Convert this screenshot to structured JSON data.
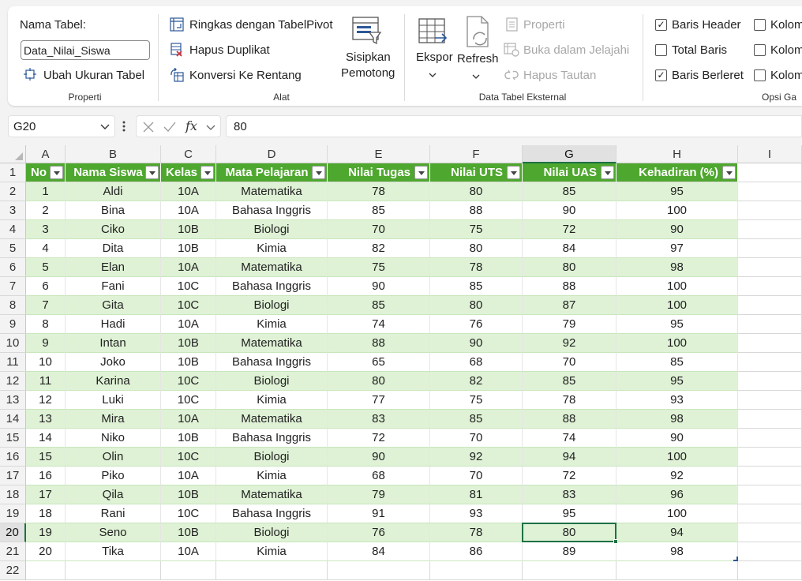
{
  "ribbon": {
    "properti": {
      "group_label": "Properti",
      "table_name_label": "Nama Tabel:",
      "table_name_value": "Data_Nilai_Siswa",
      "resize_label": "Ubah Ukuran Tabel"
    },
    "alat": {
      "group_label": "Alat",
      "pivot_label": "Ringkas dengan TabelPivot",
      "dedupe_label": "Hapus Duplikat",
      "convert_label": "Konversi Ke Rentang",
      "slicer_label_1": "Sisipkan",
      "slicer_label_2": "Pemotong"
    },
    "external": {
      "group_label": "Data Tabel Eksternal",
      "export_label": "Ekspor",
      "refresh_label": "Refresh",
      "properties_label": "Properti",
      "browser_label": "Buka dalam Jelajahi",
      "unlink_label": "Hapus Tautan"
    },
    "style_options": {
      "group_label": "Opsi Ga",
      "header_row_label": "Baris Header",
      "header_row_checked": true,
      "total_row_label": "Total Baris",
      "total_row_checked": false,
      "banded_rows_label": "Baris Berleret",
      "banded_rows_checked": true,
      "col1_label": "Kolom",
      "col2_label": "Kolom",
      "col3_label": "Kolom"
    }
  },
  "formula_bar": {
    "name_box": "G20",
    "formula": "80"
  },
  "columns": [
    "A",
    "B",
    "C",
    "D",
    "E",
    "F",
    "G",
    "H",
    "I"
  ],
  "selected_column": "G",
  "selected_row": 20,
  "table": {
    "headers": [
      "No",
      "Nama Siswa",
      "Kelas",
      "Mata Pelajaran",
      "Nilai Tugas",
      "Nilai UTS",
      "Nilai UAS",
      "Kehadiran (%)"
    ],
    "rows": [
      [
        "1",
        "Aldi",
        "10A",
        "Matematika",
        "78",
        "80",
        "85",
        "95"
      ],
      [
        "2",
        "Bina",
        "10A",
        "Bahasa Inggris",
        "85",
        "88",
        "90",
        "100"
      ],
      [
        "3",
        "Ciko",
        "10B",
        "Biologi",
        "70",
        "75",
        "72",
        "90"
      ],
      [
        "4",
        "Dita",
        "10B",
        "Kimia",
        "82",
        "80",
        "84",
        "97"
      ],
      [
        "5",
        "Elan",
        "10A",
        "Matematika",
        "75",
        "78",
        "80",
        "98"
      ],
      [
        "6",
        "Fani",
        "10C",
        "Bahasa Inggris",
        "90",
        "85",
        "88",
        "100"
      ],
      [
        "7",
        "Gita",
        "10C",
        "Biologi",
        "85",
        "80",
        "87",
        "100"
      ],
      [
        "8",
        "Hadi",
        "10A",
        "Kimia",
        "74",
        "76",
        "79",
        "95"
      ],
      [
        "9",
        "Intan",
        "10B",
        "Matematika",
        "88",
        "90",
        "92",
        "100"
      ],
      [
        "10",
        "Joko",
        "10B",
        "Bahasa Inggris",
        "65",
        "68",
        "70",
        "85"
      ],
      [
        "11",
        "Karina",
        "10C",
        "Biologi",
        "80",
        "82",
        "85",
        "95"
      ],
      [
        "12",
        "Luki",
        "10C",
        "Kimia",
        "77",
        "75",
        "78",
        "93"
      ],
      [
        "13",
        "Mira",
        "10A",
        "Matematika",
        "83",
        "85",
        "88",
        "98"
      ],
      [
        "14",
        "Niko",
        "10B",
        "Bahasa Inggris",
        "72",
        "70",
        "74",
        "90"
      ],
      [
        "15",
        "Olin",
        "10C",
        "Biologi",
        "90",
        "92",
        "94",
        "100"
      ],
      [
        "16",
        "Piko",
        "10A",
        "Kimia",
        "68",
        "70",
        "72",
        "92"
      ],
      [
        "17",
        "Qila",
        "10B",
        "Matematika",
        "79",
        "81",
        "83",
        "96"
      ],
      [
        "18",
        "Rani",
        "10C",
        "Bahasa Inggris",
        "91",
        "93",
        "95",
        "100"
      ],
      [
        "19",
        "Seno",
        "10B",
        "Biologi",
        "76",
        "78",
        "80",
        "94"
      ],
      [
        "20",
        "Tika",
        "10A",
        "Kimia",
        "84",
        "86",
        "89",
        "98"
      ]
    ]
  },
  "colors": {
    "header_green": "#4ea72e",
    "band_green": "#dff2d6",
    "selection_green": "#1e7145"
  }
}
